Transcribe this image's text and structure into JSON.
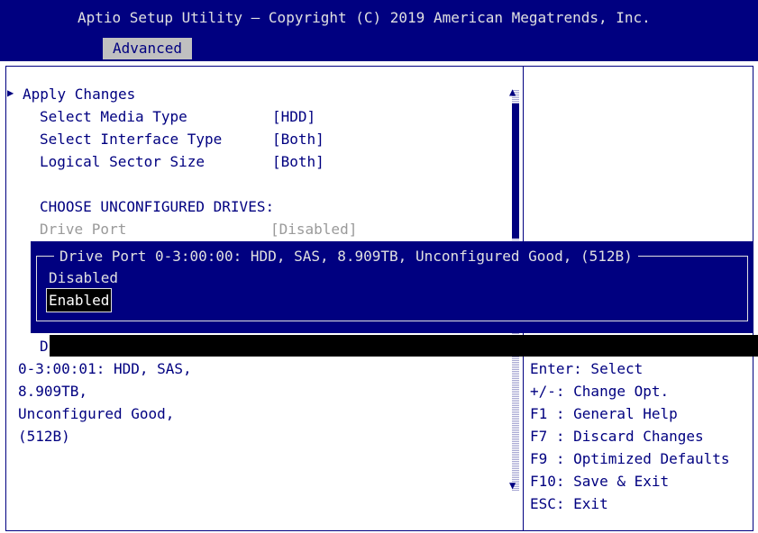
{
  "header": {
    "title": "Aptio Setup Utility – Copyright (C) 2019 American Megatrends, Inc.",
    "active_tab": "Advanced"
  },
  "menu": {
    "apply_changes": "Apply Changes",
    "items": [
      {
        "label": "Select Media Type",
        "value": "[HDD]"
      },
      {
        "label": "Select Interface Type",
        "value": "[Both]"
      },
      {
        "label": "Logical Sector Size",
        "value": "[Both]"
      }
    ],
    "section_heading": "CHOOSE UNCONFIGURED DRIVES:",
    "drive_port": {
      "label": "Drive Port",
      "value": "[Disabled]"
    },
    "partial_item": "D"
  },
  "drive_description": [
    "0-3:00:01: HDD, SAS,",
    "8.909TB,",
    "Unconfigured Good,",
    "(512B)"
  ],
  "popup": {
    "title": "Drive Port 0-3:00:00: HDD, SAS, 8.909TB, Unconfigured Good, (512B)",
    "options": [
      "Disabled",
      "Enabled"
    ],
    "selected": "Enabled"
  },
  "help": [
    "Enter: Select",
    "+/-: Change Opt.",
    "F1 : General Help",
    "F7 : Discard Changes",
    "F9 : Optimized Defaults",
    "F10: Save & Exit",
    "ESC: Exit"
  ],
  "colors": {
    "background": "#ffffff",
    "accent": "#000080",
    "highlight": "#000000"
  }
}
